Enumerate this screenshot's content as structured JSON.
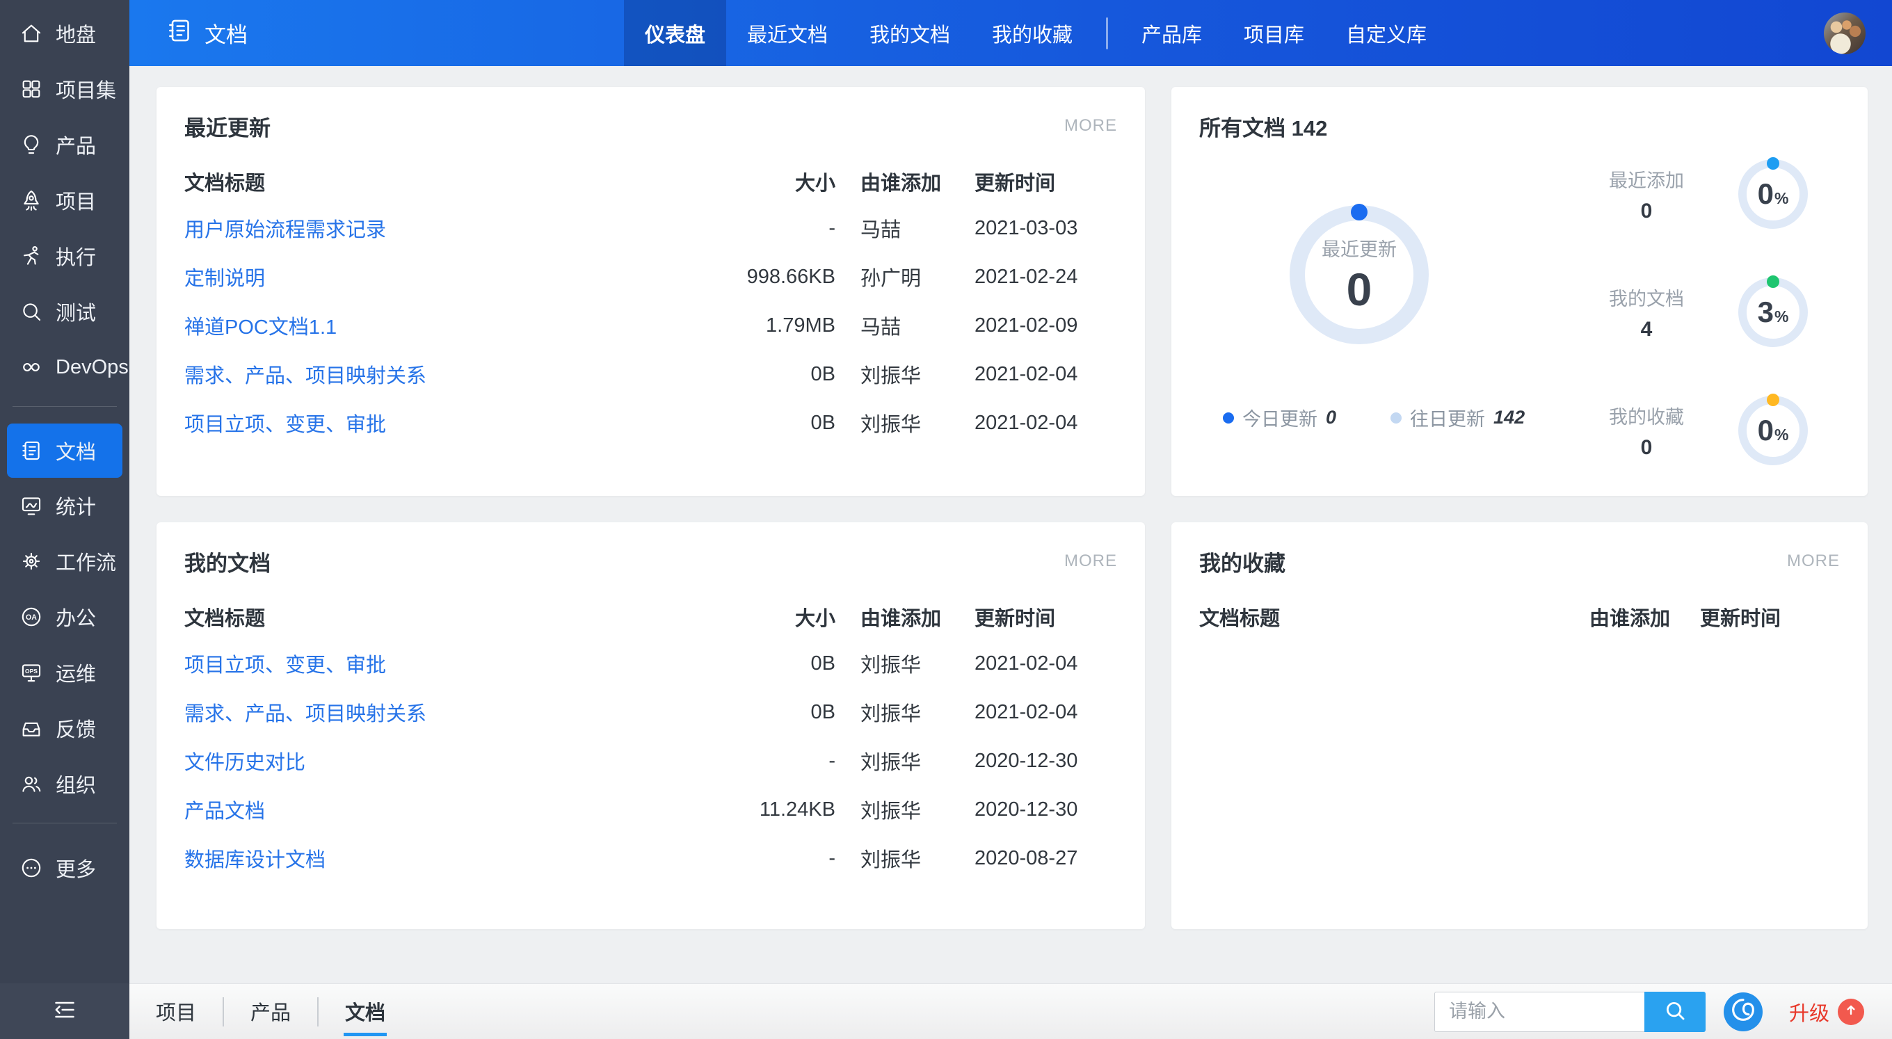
{
  "colors": {
    "header_gradient_left": "#1a78ee",
    "header_gradient_right": "#1247d2",
    "sidebar_bg": "#3a4252",
    "sidebar_active_blue": "#1472ea",
    "link_blue": "#2673e8",
    "donut_ring": "#dfe9f7",
    "legend_today_blue": "#1a6cf0",
    "legend_past_lightblue": "#c3d8f2",
    "mini_dot_blue": "#1e9df2",
    "mini_dot_green": "#1ec56f",
    "mini_dot_orange": "#ffb822",
    "tab_underline_blue": "#2196f3",
    "search_button_blue": "#2aa2f0",
    "upgrade_red": "#e8392b"
  },
  "sidebar": {
    "groups": [
      {
        "items": [
          {
            "label": "地盘",
            "icon": "home-icon"
          },
          {
            "label": "项目集",
            "icon": "grid-icon"
          },
          {
            "label": "产品",
            "icon": "bulb-icon"
          },
          {
            "label": "项目",
            "icon": "rocket-icon"
          },
          {
            "label": "执行",
            "icon": "runner-icon"
          },
          {
            "label": "测试",
            "icon": "magnifier-icon"
          },
          {
            "label": "DevOps",
            "icon": "infinity-icon"
          }
        ]
      },
      {
        "items": [
          {
            "label": "文档",
            "icon": "notebook-icon",
            "active": true
          },
          {
            "label": "统计",
            "icon": "chart-icon"
          },
          {
            "label": "工作流",
            "icon": "gear-icon"
          },
          {
            "label": "办公",
            "icon": "oa-icon"
          },
          {
            "label": "运维",
            "icon": "ops-icon"
          },
          {
            "label": "反馈",
            "icon": "inbox-icon"
          },
          {
            "label": "组织",
            "icon": "people-icon"
          }
        ]
      },
      {
        "items": [
          {
            "label": "更多",
            "icon": "more-icon"
          }
        ]
      }
    ]
  },
  "header": {
    "title": "文档",
    "nav": [
      {
        "label": "仪表盘",
        "active": true
      },
      {
        "label": "最近文档"
      },
      {
        "label": "我的文档"
      },
      {
        "label": "我的收藏"
      }
    ],
    "libs": [
      {
        "label": "产品库"
      },
      {
        "label": "项目库"
      },
      {
        "label": "自定义库"
      }
    ]
  },
  "cards": {
    "recent": {
      "title": "最近更新",
      "more": "MORE",
      "columns": [
        "文档标题",
        "大小",
        "由谁添加",
        "更新时间"
      ],
      "rows": [
        [
          "用户原始流程需求记录",
          "-",
          "马喆",
          "2021-03-03"
        ],
        [
          "定制说明",
          "998.66KB",
          "孙广明",
          "2021-02-24"
        ],
        [
          "禅道POC文档1.1",
          "1.79MB",
          "马喆",
          "2021-02-09"
        ],
        [
          "需求、产品、项目映射关系",
          "0B",
          "刘振华",
          "2021-02-04"
        ],
        [
          "项目立项、变更、审批",
          "0B",
          "刘振华",
          "2021-02-04"
        ]
      ]
    },
    "stats": {
      "title": "所有文档",
      "total": "142",
      "big_donut": {
        "label": "最近更新",
        "value": "0"
      },
      "legend": [
        {
          "label": "今日更新",
          "value": "0"
        },
        {
          "label": "往日更新",
          "value": "142"
        }
      ],
      "minis": [
        {
          "label": "最近添加",
          "count": "0",
          "percent": "0",
          "unit": "%",
          "color": "#1e9df2"
        },
        {
          "label": "我的文档",
          "count": "4",
          "percent": "3",
          "unit": "%",
          "color": "#1ec56f"
        },
        {
          "label": "我的收藏",
          "count": "0",
          "percent": "0",
          "unit": "%",
          "color": "#ffb822"
        }
      ]
    },
    "mine": {
      "title": "我的文档",
      "more": "MORE",
      "columns": [
        "文档标题",
        "大小",
        "由谁添加",
        "更新时间"
      ],
      "rows": [
        [
          "项目立项、变更、审批",
          "0B",
          "刘振华",
          "2021-02-04"
        ],
        [
          "需求、产品、项目映射关系",
          "0B",
          "刘振华",
          "2021-02-04"
        ],
        [
          "文件历史对比",
          "-",
          "刘振华",
          "2020-12-30"
        ],
        [
          "产品文档",
          "11.24KB",
          "刘振华",
          "2020-12-30"
        ],
        [
          "数据库设计文档",
          "-",
          "刘振华",
          "2020-08-27"
        ]
      ]
    },
    "fav": {
      "title": "我的收藏",
      "more": "MORE",
      "columns": [
        "文档标题",
        "由谁添加",
        "更新时间"
      ],
      "rows": []
    }
  },
  "footer": {
    "tabs": [
      {
        "label": "项目"
      },
      {
        "label": "产品"
      },
      {
        "label": "文档",
        "active": true
      }
    ],
    "search_placeholder": "请输入",
    "upgrade_label": "升级"
  },
  "chart_data": [
    {
      "type": "pie",
      "title": "最近更新",
      "categories": [
        "今日更新",
        "往日更新"
      ],
      "values": [
        0,
        142
      ],
      "center_value": 0
    },
    {
      "type": "pie",
      "title": "最近添加",
      "values": [
        0
      ],
      "percent": 0,
      "count": 0
    },
    {
      "type": "pie",
      "title": "我的文档",
      "values": [
        4
      ],
      "percent": 3,
      "count": 4
    },
    {
      "type": "pie",
      "title": "我的收藏",
      "values": [
        0
      ],
      "percent": 0,
      "count": 0
    }
  ]
}
